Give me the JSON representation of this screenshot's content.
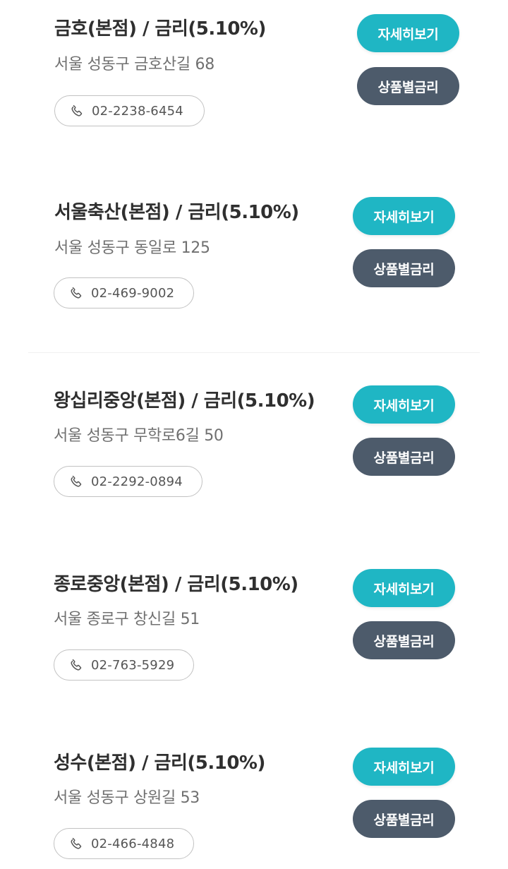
{
  "branches": [
    {
      "title": "금호(본점) / 금리(5.10%)",
      "address": "서울 성동구 금호산길 68",
      "phone": "02-2238-6454",
      "detail_label": "자세히보기",
      "rate_label": "상품별금리"
    },
    {
      "title": "서울축산(본점) / 금리(5.10%)",
      "address": "서울 성동구 동일로 125",
      "phone": "02-469-9002",
      "detail_label": "자세히보기",
      "rate_label": "상품별금리"
    },
    {
      "title": "왕십리중앙(본점) / 금리(5.10%)",
      "address": "서울 성동구 무학로6길 50",
      "phone": "02-2292-0894",
      "detail_label": "자세히보기",
      "rate_label": "상품별금리"
    },
    {
      "title": "종로중앙(본점) / 금리(5.10%)",
      "address": "서울 종로구 창신길 51",
      "phone": "02-763-5929",
      "detail_label": "자세히보기",
      "rate_label": "상품별금리"
    },
    {
      "title": "성수(본점) / 금리(5.10%)",
      "address": "서울 성동구 상원길 53",
      "phone": "02-466-4848",
      "detail_label": "자세히보기",
      "rate_label": "상품별금리"
    }
  ],
  "colors": {
    "detail_button": "#1fb6c4",
    "rate_button": "#4d5b6b"
  },
  "icons": {
    "phone": "phone-icon"
  }
}
